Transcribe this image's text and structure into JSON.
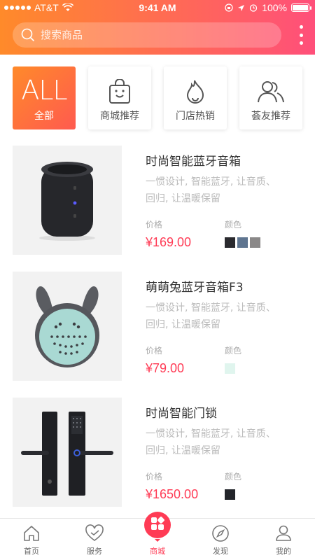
{
  "status_bar": {
    "carrier": "AT&T",
    "time": "9:41 AM",
    "battery": "100%"
  },
  "search": {
    "placeholder": "搜索商品",
    "value": ""
  },
  "categories": [
    {
      "label": "全部",
      "icon": "all-text-icon",
      "glyph": "ALL",
      "active": true
    },
    {
      "label": "商城推荐",
      "icon": "shopping-bag-icon",
      "active": false
    },
    {
      "label": "门店热销",
      "icon": "flame-icon",
      "active": false
    },
    {
      "label": "荟友推荐",
      "icon": "users-icon",
      "active": false
    }
  ],
  "product_labels": {
    "price": "价格",
    "color": "颜色"
  },
  "products": [
    {
      "title": "时尚智能蓝牙音箱",
      "description": "一惯设计, 智能蓝牙, 让音质、回归, 让温暖保留",
      "price": "¥169.00",
      "image_icon": "speaker-image",
      "colors": [
        "#2a2a2e",
        "#5f7590",
        "#8a8888"
      ]
    },
    {
      "title": "萌萌兔蓝牙音箱F3",
      "description": "一惯设计, 智能蓝牙, 让音质、回归, 让温暖保留",
      "price": "¥79.00",
      "image_icon": "bunny-speaker-image",
      "colors": [
        "#e0f5ee"
      ]
    },
    {
      "title": "时尚智能门锁",
      "description": "一惯设计, 智能蓝牙, 让音质、回归, 让温暖保留",
      "price": "¥1650.00",
      "image_icon": "door-lock-image",
      "colors": [
        "#23252a"
      ]
    }
  ],
  "tabbar": [
    {
      "label": "首页",
      "icon": "home-icon",
      "active": false
    },
    {
      "label": "服务",
      "icon": "heart-icon",
      "active": false
    },
    {
      "label": "商城",
      "icon": "store-grid-icon",
      "active": true
    },
    {
      "label": "发现",
      "icon": "compass-icon",
      "active": false
    },
    {
      "label": "我的",
      "icon": "user-icon",
      "active": false
    }
  ],
  "colors": {
    "accent": "#ff3b55",
    "header_gradient": [
      "#ff8a2a",
      "#ff4f7a"
    ]
  }
}
